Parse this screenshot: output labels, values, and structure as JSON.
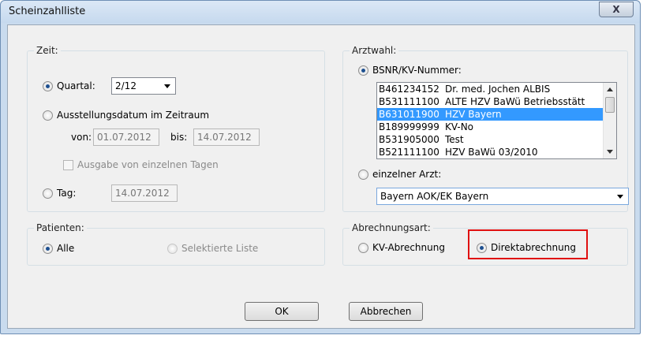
{
  "window": {
    "title": "Scheinzahlliste",
    "close_label": "X"
  },
  "zeit": {
    "label": "Zeit:",
    "quartal_label": "Quartal:",
    "quartal_value": "2/12",
    "zeitraum_label": "Ausstellungsdatum im Zeitraum",
    "von_label": "von:",
    "von_value": "01.07.2012",
    "bis_label": "bis:",
    "bis_value": "14.07.2012",
    "einzelne_tage_label": "Ausgabe von einzelnen Tagen",
    "tag_label": "Tag:",
    "tag_value": "14.07.2012"
  },
  "patienten": {
    "label": "Patienten:",
    "alle_label": "Alle",
    "selektierte_label": "Selektierte Liste"
  },
  "arztwahl": {
    "label": "Arztwahl:",
    "bsnr_label": "BSNR/KV-Nummer:",
    "list": [
      {
        "id": "B461234152",
        "name": "Dr. med. Jochen ALBIS"
      },
      {
        "id": "B531111100",
        "name": "ALTE HZV BaWü Betriebsstätt"
      },
      {
        "id": "B631011900",
        "name": "HZV Bayern"
      },
      {
        "id": "B189999999",
        "name": "KV-No"
      },
      {
        "id": "B531905000",
        "name": "Test"
      },
      {
        "id": "B521111100",
        "name": "HZV BaWü 03/2010"
      }
    ],
    "selected_index": 2,
    "einzelner_arzt_label": "einzelner Arzt:",
    "arzt_value": "Bayern AOK/EK Bayern"
  },
  "abrechnungsart": {
    "label": "Abrechnungsart:",
    "kv_label": "KV-Abrechnung",
    "direkt_label": "Direktabrechnung"
  },
  "buttons": {
    "ok_label": "OK",
    "abbrechen_label": "Abbrechen"
  },
  "colors": {
    "selection": "#3399ff",
    "highlight": "#e01010",
    "window_frame": "#c9dbee"
  }
}
